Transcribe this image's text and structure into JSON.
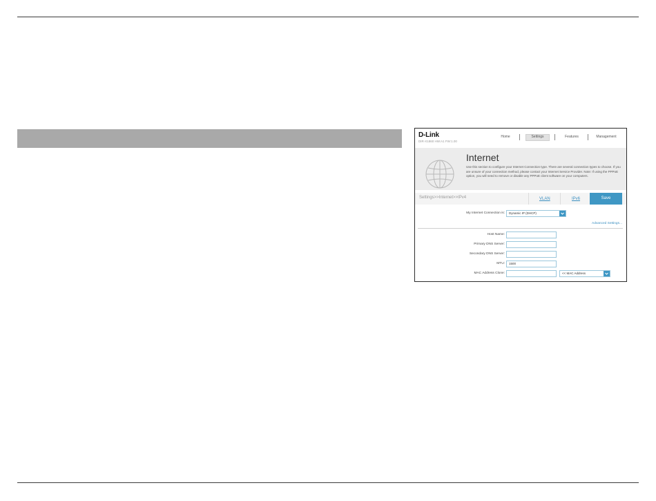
{
  "brand": {
    "logo": "D-Link",
    "model": "DIR-X1860 HW:A1 FW:1.00"
  },
  "nav": {
    "items": [
      "Home",
      "Settings",
      "Features",
      "Management"
    ],
    "active": "Settings"
  },
  "banner": {
    "title": "Internet",
    "description": "Use this section to configure your Internet Connection type. There are several connection types to choose. If you are unsure of your connection method, please contact your Internet Service Provider. Note: If using the PPPoE option, you will need to remove or disable any PPPoE client software on your computers."
  },
  "breadcrumb": "Settings>>Internet>>IPv4",
  "tabs": [
    "VLAN",
    "IPv6"
  ],
  "save_label": "Save",
  "form": {
    "connection_label": "My Internet Connection is:",
    "connection_value": "Dynamic IP (DHCP)",
    "advanced_link": "Advanced Settings...",
    "host_name_label": "Host Name:",
    "host_name_value": "",
    "primary_dns_label": "Primary DNS Server:",
    "primary_dns_value": "",
    "secondary_dns_label": "Secondary DNS Server:",
    "secondary_dns_value": "",
    "mtu_label": "MTU:",
    "mtu_value": "1500",
    "mac_label": "MAC Address Clone:",
    "mac_value": "",
    "mac_select_value": "<< MAC Address"
  },
  "colors": {
    "accent": "#3f97c4",
    "section_bar": "#a9a9a9"
  }
}
